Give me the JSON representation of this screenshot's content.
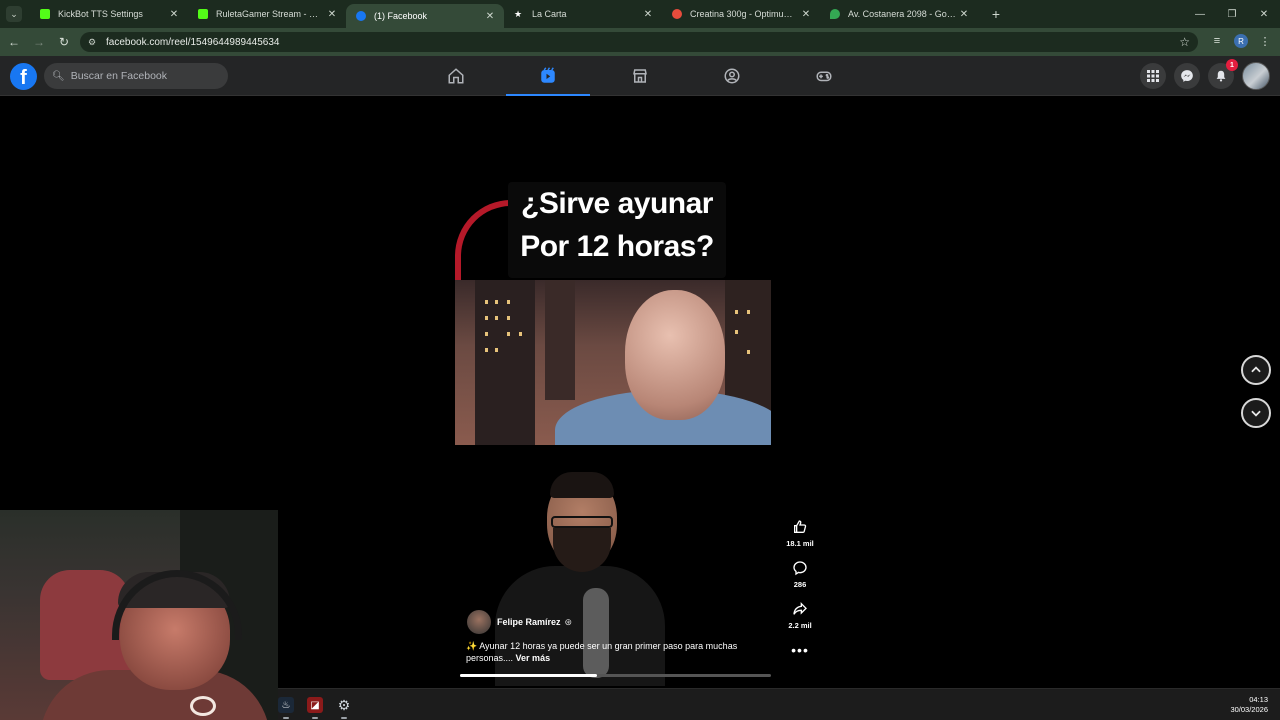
{
  "browser": {
    "tabs": [
      {
        "title": "KickBot TTS Settings",
        "favicon_color": "#53fc18",
        "active": false
      },
      {
        "title": "RuletaGamer Stream - Watch Li",
        "favicon_color": "#53fc18",
        "active": false
      },
      {
        "title": "(1) Facebook",
        "favicon_color": "#1877f2",
        "active": true
      },
      {
        "title": "La Carta",
        "favicon_color": "#ffffff",
        "active": false
      },
      {
        "title": "Creatina 300g - Optimum - Nu",
        "favicon_color": "#e74c3c",
        "active": false
      },
      {
        "title": "Av. Costanera 2098 - Google M",
        "favicon_color": "#34a853",
        "active": false
      }
    ],
    "url": "facebook.com/reel/1549644989445634",
    "profile_initial": "R"
  },
  "facebook": {
    "search_placeholder": "Buscar en Facebook",
    "notifications_count": "1",
    "accent_color": "#2d88ff"
  },
  "reel": {
    "title_line1": "¿Sirve ayunar",
    "title_line2": "Por 12 horas?",
    "author": "Felipe Ramírez",
    "caption": "✨ Ayunar 12 horas ya puede ser un gran primer paso para muchas personas....",
    "see_more": "Ver más",
    "progress": 0.44,
    "likes": "18.1 mil",
    "comments": "286",
    "shares": "2.2 mil"
  },
  "taskbar": {
    "time": "04:13",
    "date": "30/03/2026"
  }
}
